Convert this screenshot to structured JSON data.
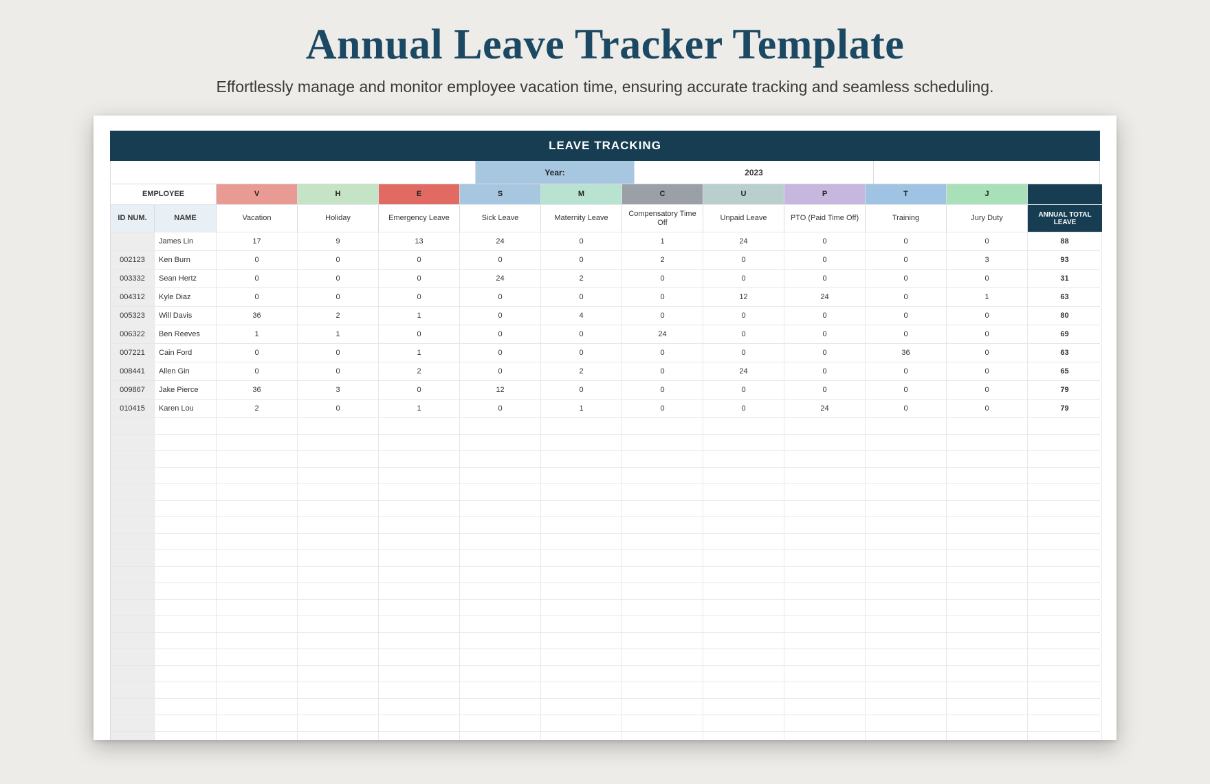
{
  "page": {
    "title": "Annual Leave Tracker Template",
    "subtitle": "Effortlessly manage and monitor employee vacation time, ensuring accurate tracking and seamless scheduling."
  },
  "sheet": {
    "banner": "LEAVE TRACKING",
    "year_label": "Year:",
    "year_value": "2023",
    "employee_header": "EMPLOYEE",
    "id_header": "ID NUM.",
    "name_header": "NAME",
    "total_header": "ANNUAL TOTAL LEAVE"
  },
  "leave_types": [
    {
      "code": "V",
      "label": "Vacation"
    },
    {
      "code": "H",
      "label": "Holiday"
    },
    {
      "code": "E",
      "label": "Emergency Leave"
    },
    {
      "code": "S",
      "label": "Sick Leave"
    },
    {
      "code": "M",
      "label": "Maternity Leave"
    },
    {
      "code": "C",
      "label": "Compensatory Time Off"
    },
    {
      "code": "U",
      "label": "Unpaid Leave"
    },
    {
      "code": "P",
      "label": "PTO (Paid Time Off)"
    },
    {
      "code": "T",
      "label": "Training"
    },
    {
      "code": "J",
      "label": "Jury Duty"
    }
  ],
  "employees": [
    {
      "id": "",
      "name": "James Lin",
      "values": [
        17,
        9,
        13,
        24,
        0,
        1,
        24,
        0,
        0,
        0
      ],
      "total": 88
    },
    {
      "id": "002123",
      "name": "Ken Burn",
      "values": [
        0,
        0,
        0,
        0,
        0,
        2,
        0,
        0,
        0,
        3
      ],
      "total": 93
    },
    {
      "id": "003332",
      "name": "Sean Hertz",
      "values": [
        0,
        0,
        0,
        24,
        2,
        0,
        0,
        0,
        0,
        0
      ],
      "total": 31
    },
    {
      "id": "004312",
      "name": "Kyle Diaz",
      "values": [
        0,
        0,
        0,
        0,
        0,
        0,
        12,
        24,
        0,
        1
      ],
      "total": 63
    },
    {
      "id": "005323",
      "name": "Will Davis",
      "values": [
        36,
        2,
        1,
        0,
        4,
        0,
        0,
        0,
        0,
        0
      ],
      "total": 80
    },
    {
      "id": "006322",
      "name": "Ben Reeves",
      "values": [
        1,
        1,
        0,
        0,
        0,
        24,
        0,
        0,
        0,
        0
      ],
      "total": 69
    },
    {
      "id": "007221",
      "name": "Cain Ford",
      "values": [
        0,
        0,
        1,
        0,
        0,
        0,
        0,
        0,
        36,
        0
      ],
      "total": 63
    },
    {
      "id": "008441",
      "name": "Allen Gin",
      "values": [
        0,
        0,
        2,
        0,
        2,
        0,
        24,
        0,
        0,
        0
      ],
      "total": 65
    },
    {
      "id": "009867",
      "name": "Jake Pierce",
      "values": [
        36,
        3,
        0,
        12,
        0,
        0,
        0,
        0,
        0,
        0
      ],
      "total": 79
    },
    {
      "id": "010415",
      "name": "Karen Lou",
      "values": [
        2,
        0,
        1,
        0,
        1,
        0,
        0,
        24,
        0,
        0
      ],
      "total": 79
    }
  ],
  "empty_row_count": 20,
  "chart_data": {
    "type": "table",
    "title": "LEAVE TRACKING",
    "year": 2023,
    "columns": [
      "ID NUM.",
      "NAME",
      "Vacation",
      "Holiday",
      "Emergency Leave",
      "Sick Leave",
      "Maternity Leave",
      "Compensatory Time Off",
      "Unpaid Leave",
      "PTO (Paid Time Off)",
      "Training",
      "Jury Duty",
      "ANNUAL TOTAL LEAVE"
    ],
    "codes": [
      "V",
      "H",
      "E",
      "S",
      "M",
      "C",
      "U",
      "P",
      "T",
      "J"
    ],
    "rows": [
      [
        "",
        "James Lin",
        17,
        9,
        13,
        24,
        0,
        1,
        24,
        0,
        0,
        0,
        88
      ],
      [
        "002123",
        "Ken Burn",
        0,
        0,
        0,
        0,
        0,
        2,
        0,
        0,
        0,
        3,
        93
      ],
      [
        "003332",
        "Sean Hertz",
        0,
        0,
        0,
        24,
        2,
        0,
        0,
        0,
        0,
        0,
        31
      ],
      [
        "004312",
        "Kyle Diaz",
        0,
        0,
        0,
        0,
        0,
        0,
        12,
        24,
        0,
        1,
        63
      ],
      [
        "005323",
        "Will Davis",
        36,
        2,
        1,
        0,
        4,
        0,
        0,
        0,
        0,
        0,
        80
      ],
      [
        "006322",
        "Ben Reeves",
        1,
        1,
        0,
        0,
        0,
        24,
        0,
        0,
        0,
        0,
        69
      ],
      [
        "007221",
        "Cain Ford",
        0,
        0,
        1,
        0,
        0,
        0,
        0,
        0,
        36,
        0,
        63
      ],
      [
        "008441",
        "Allen Gin",
        0,
        0,
        2,
        0,
        2,
        0,
        24,
        0,
        0,
        0,
        65
      ],
      [
        "009867",
        "Jake Pierce",
        36,
        3,
        0,
        12,
        0,
        0,
        0,
        0,
        0,
        0,
        79
      ],
      [
        "010415",
        "Karen Lou",
        2,
        0,
        1,
        0,
        1,
        0,
        0,
        24,
        0,
        0,
        79
      ]
    ]
  }
}
